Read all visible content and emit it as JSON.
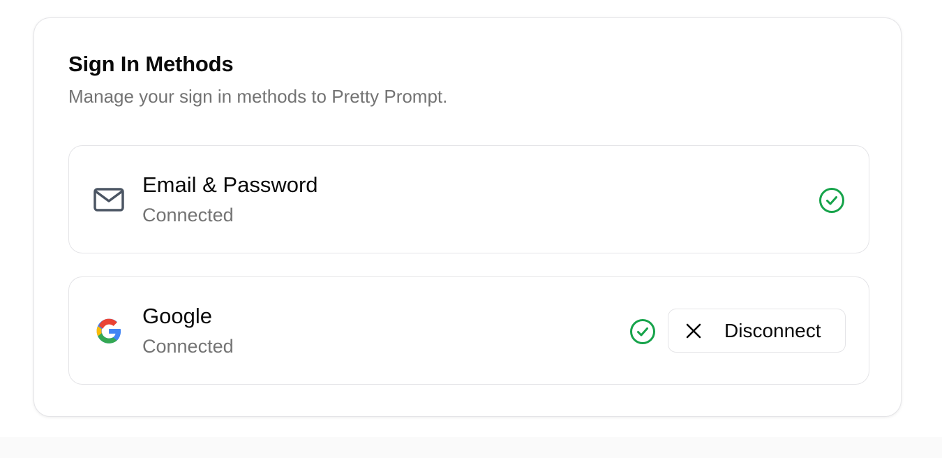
{
  "card": {
    "title": "Sign In Methods",
    "description": "Manage your sign in methods to Pretty Prompt."
  },
  "methods": [
    {
      "name": "Email & Password",
      "status": "Connected",
      "icon": "mail-icon",
      "connected": true
    },
    {
      "name": "Google",
      "status": "Connected",
      "icon": "google-icon",
      "connected": true,
      "action_label": "Disconnect",
      "action_icon": "close-icon"
    }
  ],
  "colors": {
    "success": "#16a34a",
    "muted_text": "#737373",
    "border": "#e4e4e7"
  }
}
